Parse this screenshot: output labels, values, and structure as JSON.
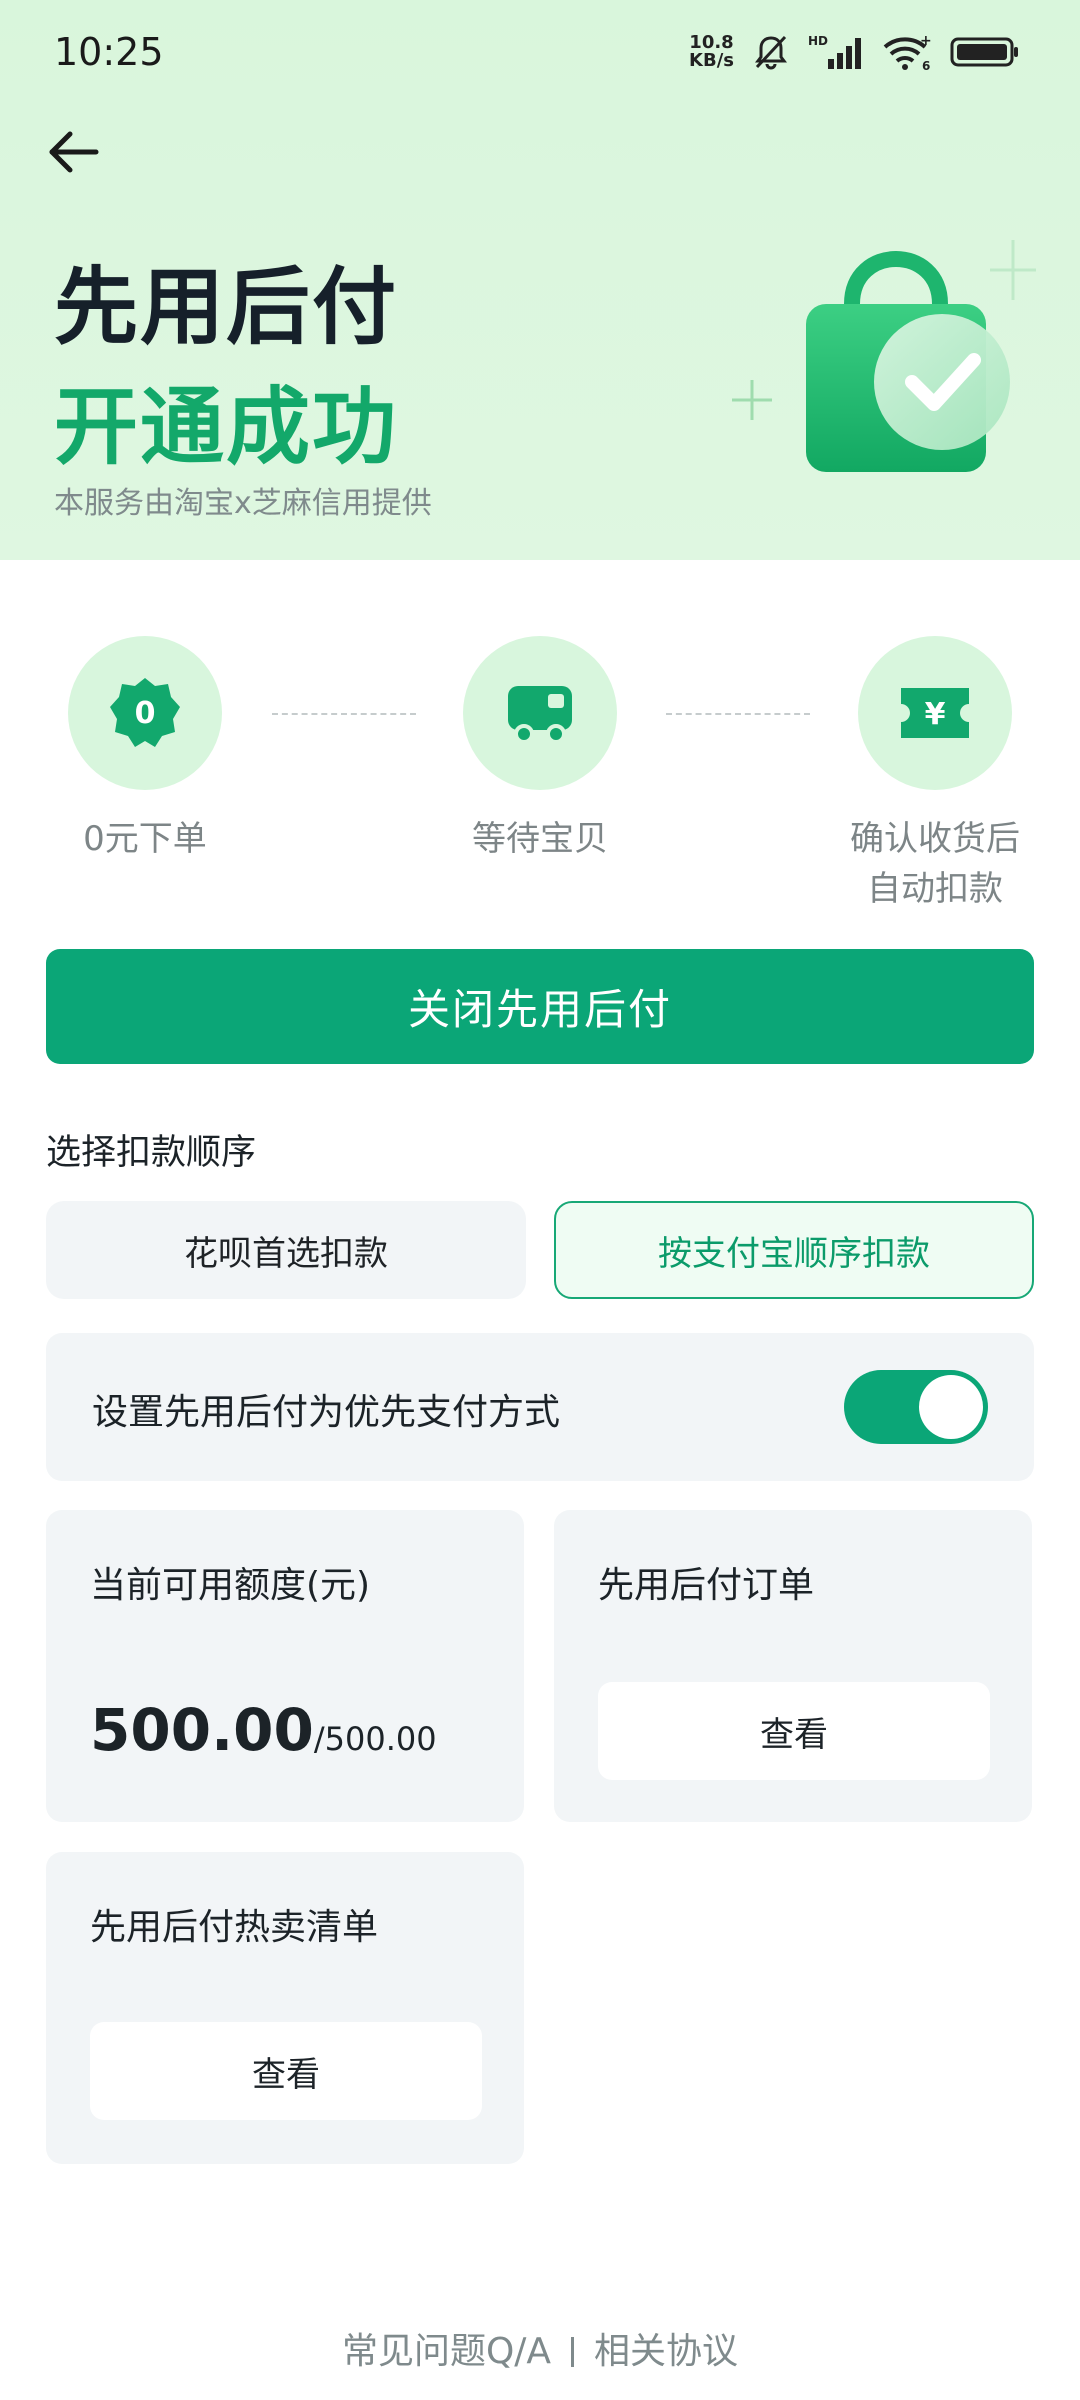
{
  "status_bar": {
    "time": "10:25",
    "net_speed_value": "10.8",
    "net_speed_unit": "KB/s",
    "icons": [
      "mute-bell-icon",
      "hd-signal-icon",
      "wifi-icon",
      "battery-icon"
    ]
  },
  "header": {
    "title": "先用后付",
    "subtitle": "开通成功",
    "note": "本服务由淘宝x芝麻信用提供"
  },
  "steps": [
    {
      "icon": "zero-badge-icon",
      "badge_text": "0",
      "label_line1": "0元下单",
      "label_line2": ""
    },
    {
      "icon": "truck-icon",
      "label_line1": "等待宝贝",
      "label_line2": ""
    },
    {
      "icon": "yuan-ticket-icon",
      "badge_text": "¥",
      "label_line1": "确认收货后",
      "label_line2": "自动扣款"
    }
  ],
  "close_button": "关闭先用后付",
  "deduction": {
    "label": "选择扣款顺序",
    "options": [
      "花呗首选扣款",
      "按支付宝顺序扣款"
    ],
    "selected_index": 1
  },
  "preference": {
    "label": "设置先用后付为优先支付方式",
    "toggle_on": true
  },
  "credit": {
    "title": "当前可用额度(元)",
    "available": "500.00",
    "slash": "/",
    "total": "500.00"
  },
  "orders": {
    "title": "先用后付订单",
    "button": "查看"
  },
  "hot_list": {
    "title": "先用后付热卖清单",
    "button": "查看"
  },
  "footer": {
    "faq": "常见问题Q/A",
    "agreement": "相关协议"
  },
  "colors": {
    "accent": "#0ba677",
    "hero_bg": "#d9f6dc",
    "tile_bg": "#f2f5f7"
  }
}
